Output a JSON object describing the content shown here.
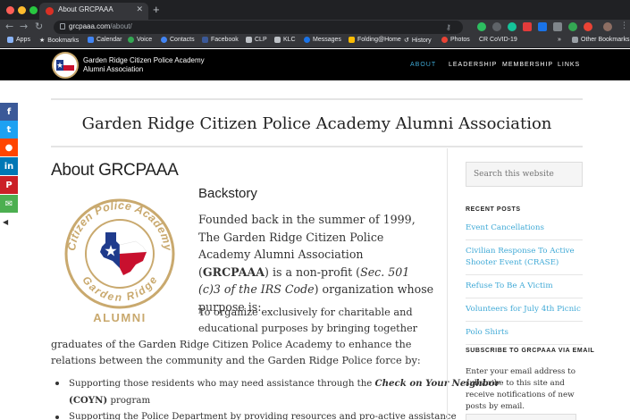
{
  "browser": {
    "tab_title": "About GRCPAAA",
    "url_host": "grcpaaa.com",
    "url_path": "/about/",
    "bookmarks": [
      "Apps",
      "Bookmarks",
      "Calendar",
      "Voice",
      "Contacts",
      "Facebook",
      "CLP",
      "KLC",
      "Messages",
      "Folding@Home",
      "History",
      "Photos",
      "CR CoVID-19"
    ],
    "other_bookmarks": "Other Bookmarks"
  },
  "site": {
    "name_line1": "Garden Ridge Citizen Police Academy",
    "name_line2": "Alumni Association",
    "nav": [
      "ABOUT",
      "LEADERSHIP",
      "MEMBERSHIP",
      "LINKS"
    ],
    "page_title": "Garden Ridge Citizen Police Academy Alumni Association"
  },
  "article": {
    "title": "About GRCPAAA",
    "subheading": "Backstory",
    "para1_a": "Founded back in the summer of 1999, The Garden Ridge Citizen Police Academy Alumni Association (",
    "para1_bold": "GRCPAAA",
    "para1_b": ") is a non-profit (",
    "para1_italic": "Sec. 501 (c)3 of the IRS Code",
    "para1_c": ") organization whose purpose is:",
    "para2_a": "To organize exclusively for charitable and educational purposes by bringing together",
    "para2_b": "graduates of the Garden Ridge Citizen Police Academy to enhance the relations between the community and the Garden Ridge Police force by:",
    "bullet1_a": "Supporting those residents who may need assistance through the ",
    "bullet1_em": "Check on Your Neighbor",
    "bullet1_bold": "(COYN)",
    "bullet1_b": " program",
    "bullet2": "Supporting the Police Department by providing resources and pro-active assistance"
  },
  "seal": {
    "ring_text": "Citizen Police Academy",
    "bottom_text": "Garden Ridge",
    "label": "ALUMNI"
  },
  "sidebar": {
    "search_placeholder": "Search this website",
    "recent_title": "RECENT POSTS",
    "recent_posts": [
      "Event Cancellations",
      "Civilian Response To Active Shooter Event (CRASE)",
      "Refuse To Be A Victim",
      "Volunteers for July 4th Picnic",
      "Polo Shirts"
    ],
    "subscribe_title": "SUBSCRIBE TO GRCPAAA VIA EMAIL",
    "subscribe_text": "Enter your email address to subscribe to this site and receive notifications of new posts by email."
  },
  "share": {
    "icons": [
      "facebook-icon",
      "twitter-icon",
      "reddit-icon",
      "linkedin-icon",
      "pinterest-icon",
      "email-icon"
    ],
    "colors": [
      "#3b5998",
      "#1da1f2",
      "#ff4500",
      "#0077b5",
      "#cb2027",
      "#4caf50"
    ]
  },
  "colors": {
    "accent": "#3fa9d6",
    "header_bg": "#000000",
    "seal_gold": "#c9a96e",
    "texas_blue": "#1f3b8c",
    "texas_red": "#c8102e"
  }
}
